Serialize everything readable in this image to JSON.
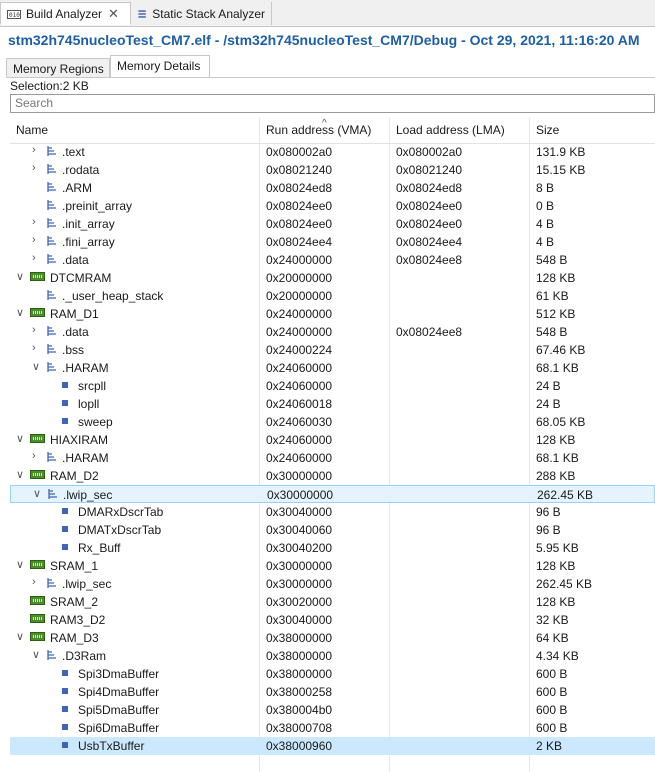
{
  "tabs": [
    {
      "label": "Build Analyzer",
      "icon": "build-analyzer-icon",
      "active": true
    },
    {
      "label": "Static Stack Analyzer",
      "icon": "stack-analyzer-icon",
      "active": false
    }
  ],
  "title": "stm32h745nucleoTest_CM7.elf - /stm32h745nucleoTest_CM7/Debug - Oct 29, 2021, 11:16:20 AM",
  "subtabs": [
    "Memory Regions",
    "Memory Details"
  ],
  "selection": "Selection:2 KB",
  "search": {
    "placeholder": "Search"
  },
  "columns": {
    "name": "Name",
    "run": "Run address (VMA)",
    "load": "Load address (LMA)",
    "size": "Size"
  },
  "rows": [
    {
      "name": ".text",
      "type": "section",
      "level": 1,
      "expand": "collapsed",
      "run": "0x080002a0",
      "load": "0x080002a0",
      "size": "131.9 KB"
    },
    {
      "name": ".rodata",
      "type": "section",
      "level": 1,
      "expand": "collapsed",
      "run": "0x08021240",
      "load": "0x08021240",
      "size": "15.15 KB"
    },
    {
      "name": ".ARM",
      "type": "section",
      "level": 1,
      "expand": "none",
      "run": "0x08024ed8",
      "load": "0x08024ed8",
      "size": "8 B"
    },
    {
      "name": ".preinit_array",
      "type": "section",
      "level": 1,
      "expand": "none",
      "run": "0x08024ee0",
      "load": "0x08024ee0",
      "size": "0 B"
    },
    {
      "name": ".init_array",
      "type": "section",
      "level": 1,
      "expand": "collapsed",
      "run": "0x08024ee0",
      "load": "0x08024ee0",
      "size": "4 B"
    },
    {
      "name": ".fini_array",
      "type": "section",
      "level": 1,
      "expand": "collapsed",
      "run": "0x08024ee4",
      "load": "0x08024ee4",
      "size": "4 B"
    },
    {
      "name": ".data",
      "type": "section",
      "level": 1,
      "expand": "collapsed",
      "run": "0x24000000",
      "load": "0x08024ee8",
      "size": "548 B"
    },
    {
      "name": "DTCMRAM",
      "type": "region",
      "level": 0,
      "expand": "expanded",
      "run": "0x20000000",
      "load": "",
      "size": "128 KB"
    },
    {
      "name": "._user_heap_stack",
      "type": "section",
      "level": 1,
      "expand": "none",
      "run": "0x20000000",
      "load": "",
      "size": "61 KB"
    },
    {
      "name": "RAM_D1",
      "type": "region",
      "level": 0,
      "expand": "expanded",
      "run": "0x24000000",
      "load": "",
      "size": "512 KB"
    },
    {
      "name": ".data",
      "type": "section",
      "level": 1,
      "expand": "collapsed",
      "run": "0x24000000",
      "load": "0x08024ee8",
      "size": "548 B"
    },
    {
      "name": ".bss",
      "type": "section",
      "level": 1,
      "expand": "collapsed",
      "run": "0x24000224",
      "load": "",
      "size": "67.46 KB"
    },
    {
      "name": ".HARAM",
      "type": "section",
      "level": 1,
      "expand": "expanded",
      "run": "0x24060000",
      "load": "",
      "size": "68.1 KB"
    },
    {
      "name": "srcpll",
      "type": "symbol",
      "level": 2,
      "expand": "none",
      "run": "0x24060000",
      "load": "",
      "size": "24 B"
    },
    {
      "name": "lopll",
      "type": "symbol",
      "level": 2,
      "expand": "none",
      "run": "0x24060018",
      "load": "",
      "size": "24 B"
    },
    {
      "name": "sweep",
      "type": "symbol",
      "level": 2,
      "expand": "none",
      "run": "0x24060030",
      "load": "",
      "size": "68.05 KB"
    },
    {
      "name": "HIAXIRAM",
      "type": "region",
      "level": 0,
      "expand": "expanded",
      "run": "0x24060000",
      "load": "",
      "size": "128 KB"
    },
    {
      "name": ".HARAM",
      "type": "section",
      "level": 1,
      "expand": "collapsed",
      "run": "0x24060000",
      "load": "",
      "size": "68.1 KB"
    },
    {
      "name": "RAM_D2",
      "type": "region",
      "level": 0,
      "expand": "expanded",
      "run": "0x30000000",
      "load": "",
      "size": "288 KB"
    },
    {
      "name": ".lwip_sec",
      "type": "section",
      "level": 1,
      "expand": "expanded",
      "run": "0x30000000",
      "load": "",
      "size": "262.45 KB",
      "state": "focus"
    },
    {
      "name": "DMARxDscrTab",
      "type": "symbol",
      "level": 2,
      "expand": "none",
      "run": "0x30040000",
      "load": "",
      "size": "96 B"
    },
    {
      "name": "DMATxDscrTab",
      "type": "symbol",
      "level": 2,
      "expand": "none",
      "run": "0x30040060",
      "load": "",
      "size": "96 B"
    },
    {
      "name": "Rx_Buff",
      "type": "symbol",
      "level": 2,
      "expand": "none",
      "run": "0x30040200",
      "load": "",
      "size": "5.95 KB"
    },
    {
      "name": "SRAM_1",
      "type": "region",
      "level": 0,
      "expand": "expanded",
      "run": "0x30000000",
      "load": "",
      "size": "128 KB"
    },
    {
      "name": ".lwip_sec",
      "type": "section",
      "level": 1,
      "expand": "collapsed",
      "run": "0x30000000",
      "load": "",
      "size": "262.45 KB"
    },
    {
      "name": "SRAM_2",
      "type": "region",
      "level": 0,
      "expand": "none",
      "run": "0x30020000",
      "load": "",
      "size": "128 KB"
    },
    {
      "name": "RAM3_D2",
      "type": "region",
      "level": 0,
      "expand": "none",
      "run": "0x30040000",
      "load": "",
      "size": "32 KB"
    },
    {
      "name": "RAM_D3",
      "type": "region",
      "level": 0,
      "expand": "expanded",
      "run": "0x38000000",
      "load": "",
      "size": "64 KB"
    },
    {
      "name": ".D3Ram",
      "type": "section",
      "level": 1,
      "expand": "expanded",
      "run": "0x38000000",
      "load": "",
      "size": "4.34 KB"
    },
    {
      "name": "Spi3DmaBuffer",
      "type": "symbol",
      "level": 2,
      "expand": "none",
      "run": "0x38000000",
      "load": "",
      "size": "600 B"
    },
    {
      "name": "Spi4DmaBuffer",
      "type": "symbol",
      "level": 2,
      "expand": "none",
      "run": "0x38000258",
      "load": "",
      "size": "600 B"
    },
    {
      "name": "Spi5DmaBuffer",
      "type": "symbol",
      "level": 2,
      "expand": "none",
      "run": "0x380004b0",
      "load": "",
      "size": "600 B"
    },
    {
      "name": "Spi6DmaBuffer",
      "type": "symbol",
      "level": 2,
      "expand": "none",
      "run": "0x38000708",
      "load": "",
      "size": "600 B"
    },
    {
      "name": "UsbTxBuffer",
      "type": "symbol",
      "level": 2,
      "expand": "none",
      "run": "0x38000960",
      "load": "",
      "size": "2 KB",
      "state": "selected"
    }
  ],
  "colors": {
    "title": "#1d5fa6",
    "selected_row": "#cce8ff",
    "memory_icon": "#4a8f2a",
    "symbol_icon": "#3e66b8"
  }
}
